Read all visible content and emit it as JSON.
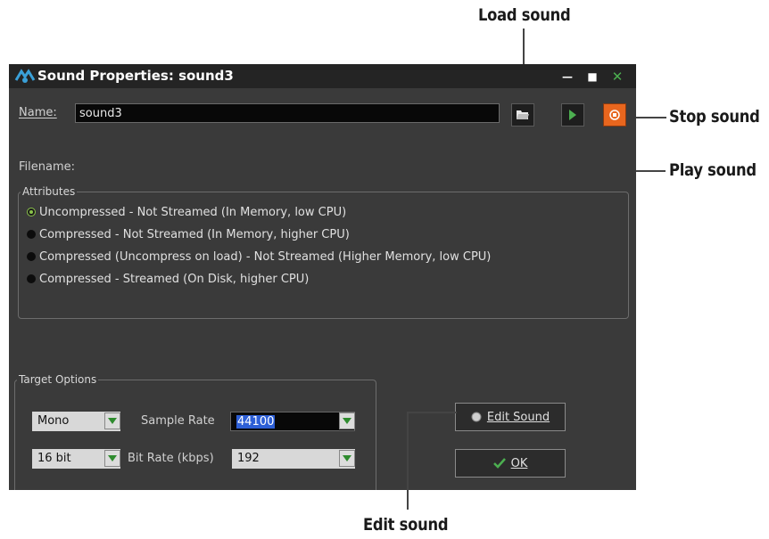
{
  "callouts": {
    "load_sound": "Load sound",
    "stop_sound": "Stop sound",
    "play_sound": "Play sound",
    "edit_sound": "Edit sound"
  },
  "window": {
    "title": "Sound Properties:  sound3",
    "controls": {
      "minimize": "—",
      "maximize": "■",
      "close": "✕"
    }
  },
  "name": {
    "label": "Name:",
    "value": "sound3"
  },
  "filename": {
    "label": "Filename:"
  },
  "attributes": {
    "legend": "Attributes",
    "options": [
      {
        "label": "Uncompressed - Not Streamed (In Memory, low CPU)",
        "selected": true
      },
      {
        "label": "Compressed - Not Streamed (In Memory, higher CPU)",
        "selected": false
      },
      {
        "label": "Compressed (Uncompress on load) - Not Streamed (Higher Memory, low CPU)",
        "selected": false
      },
      {
        "label": "Compressed - Streamed (On Disk, higher CPU)",
        "selected": false
      }
    ]
  },
  "target_options": {
    "legend": "Target Options",
    "channels": "Mono",
    "bit_depth": "16 bit",
    "sample_rate_label": "Sample Rate",
    "sample_rate": "44100",
    "bit_rate_label": "Bit Rate (kbps)",
    "bit_rate": "192"
  },
  "buttons": {
    "edit_sound": "Edit Sound",
    "ok": "OK"
  },
  "icons": {
    "load": "folder-open-icon",
    "play": "play-icon",
    "stop": "stop-icon",
    "edit": "circle-icon",
    "ok": "checkmark-icon"
  },
  "colors": {
    "accent_green": "#4caf50",
    "stop_orange": "#e8661e",
    "selection_blue": "#2d5fd6"
  }
}
